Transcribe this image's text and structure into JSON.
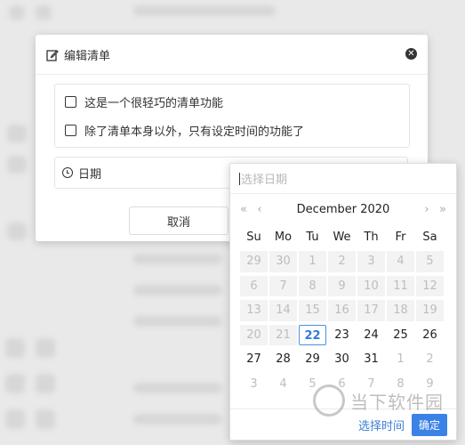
{
  "dialog": {
    "title": "编辑清单",
    "items": [
      {
        "label": "这是一个很轻巧的清单功能",
        "checked": false
      },
      {
        "label": "除了清单本身以外，只有设定时间的功能了",
        "checked": false
      }
    ],
    "date_label": "日期",
    "cancel_label": "取消"
  },
  "picker": {
    "placeholder": "选择日期",
    "month_label": "December 2020",
    "prev_year": "«",
    "prev_month": "‹",
    "next_month": "›",
    "next_year": "»",
    "weekdays": [
      "Su",
      "Mo",
      "Tu",
      "We",
      "Th",
      "Fr",
      "Sa"
    ],
    "days": [
      {
        "d": "29",
        "s": "disabled"
      },
      {
        "d": "30",
        "s": "disabled"
      },
      {
        "d": "1",
        "s": "disabled"
      },
      {
        "d": "2",
        "s": "disabled"
      },
      {
        "d": "3",
        "s": "disabled"
      },
      {
        "d": "4",
        "s": "disabled"
      },
      {
        "d": "5",
        "s": "disabled"
      },
      {
        "d": "6",
        "s": "disabled"
      },
      {
        "d": "7",
        "s": "disabled"
      },
      {
        "d": "8",
        "s": "disabled"
      },
      {
        "d": "9",
        "s": "disabled"
      },
      {
        "d": "10",
        "s": "disabled"
      },
      {
        "d": "11",
        "s": "disabled"
      },
      {
        "d": "12",
        "s": "disabled"
      },
      {
        "d": "13",
        "s": "disabled"
      },
      {
        "d": "14",
        "s": "disabled"
      },
      {
        "d": "15",
        "s": "disabled"
      },
      {
        "d": "16",
        "s": "disabled"
      },
      {
        "d": "17",
        "s": "disabled"
      },
      {
        "d": "18",
        "s": "disabled"
      },
      {
        "d": "19",
        "s": "disabled"
      },
      {
        "d": "20",
        "s": "disabled"
      },
      {
        "d": "21",
        "s": "disabled"
      },
      {
        "d": "22",
        "s": "today"
      },
      {
        "d": "23",
        "s": "normal"
      },
      {
        "d": "24",
        "s": "normal"
      },
      {
        "d": "25",
        "s": "normal"
      },
      {
        "d": "26",
        "s": "normal"
      },
      {
        "d": "27",
        "s": "normal"
      },
      {
        "d": "28",
        "s": "normal"
      },
      {
        "d": "29",
        "s": "normal"
      },
      {
        "d": "30",
        "s": "normal"
      },
      {
        "d": "31",
        "s": "normal"
      },
      {
        "d": "1",
        "s": "muted"
      },
      {
        "d": "2",
        "s": "muted"
      },
      {
        "d": "3",
        "s": "muted"
      },
      {
        "d": "4",
        "s": "muted"
      },
      {
        "d": "5",
        "s": "muted"
      },
      {
        "d": "6",
        "s": "muted"
      },
      {
        "d": "7",
        "s": "muted"
      },
      {
        "d": "8",
        "s": "muted"
      },
      {
        "d": "9",
        "s": "muted"
      }
    ],
    "select_time_label": "选择时间",
    "ok_label": "确定"
  },
  "watermark": {
    "text": "当下软件园"
  },
  "colors": {
    "accent": "#3b82e6",
    "today_border": "#4a90e2"
  },
  "icons": {
    "edit": "edit-icon",
    "close": "close-icon",
    "clock": "clock-icon"
  }
}
